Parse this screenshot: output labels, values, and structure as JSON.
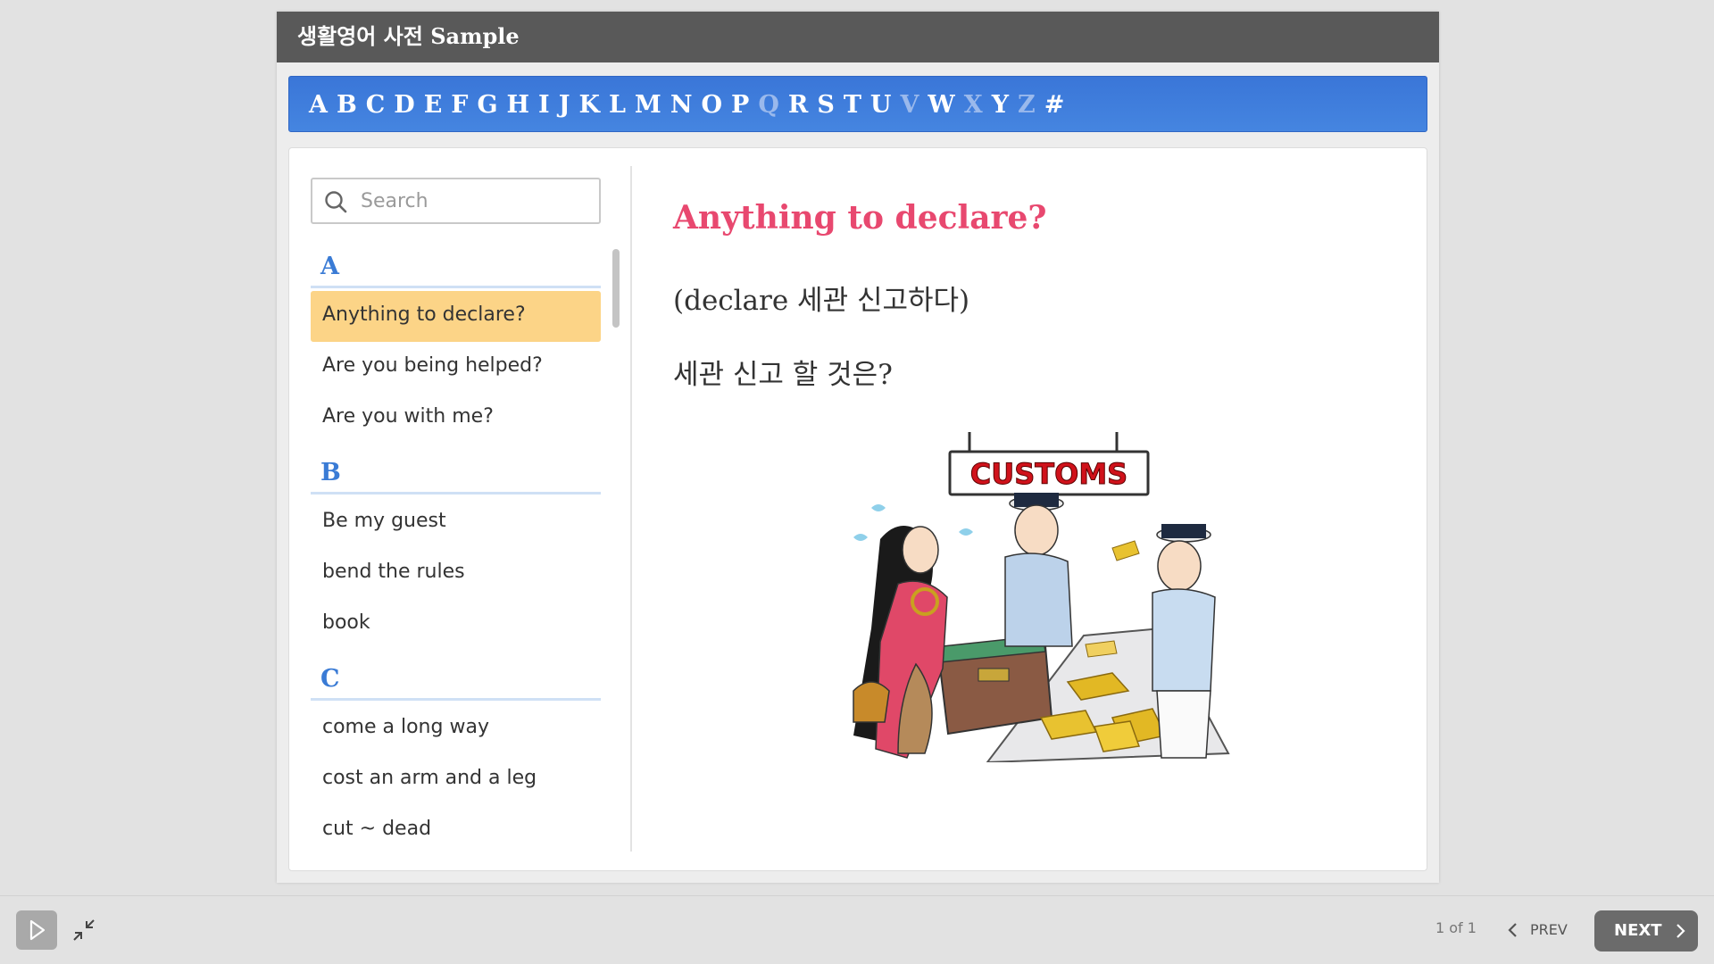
{
  "slide": {
    "title": "생활영어 사전 Sample"
  },
  "alphabet": [
    {
      "letter": "A",
      "enabled": true
    },
    {
      "letter": "B",
      "enabled": true
    },
    {
      "letter": "C",
      "enabled": true
    },
    {
      "letter": "D",
      "enabled": true
    },
    {
      "letter": "E",
      "enabled": true
    },
    {
      "letter": "F",
      "enabled": true
    },
    {
      "letter": "G",
      "enabled": true
    },
    {
      "letter": "H",
      "enabled": true
    },
    {
      "letter": "I",
      "enabled": true
    },
    {
      "letter": "J",
      "enabled": true
    },
    {
      "letter": "K",
      "enabled": true
    },
    {
      "letter": "L",
      "enabled": true
    },
    {
      "letter": "M",
      "enabled": true
    },
    {
      "letter": "N",
      "enabled": true
    },
    {
      "letter": "O",
      "enabled": true
    },
    {
      "letter": "P",
      "enabled": true
    },
    {
      "letter": "Q",
      "enabled": false
    },
    {
      "letter": "R",
      "enabled": true
    },
    {
      "letter": "S",
      "enabled": true
    },
    {
      "letter": "T",
      "enabled": true
    },
    {
      "letter": "U",
      "enabled": true
    },
    {
      "letter": "V",
      "enabled": false
    },
    {
      "letter": "W",
      "enabled": true
    },
    {
      "letter": "X",
      "enabled": false
    },
    {
      "letter": "Y",
      "enabled": true
    },
    {
      "letter": "Z",
      "enabled": false
    },
    {
      "letter": "#",
      "enabled": true
    }
  ],
  "search": {
    "placeholder": "Search",
    "value": "",
    "icon": "search-icon"
  },
  "groups": [
    {
      "letter": "A",
      "entries": [
        {
          "label": "Anything to declare?",
          "selected": true
        },
        {
          "label": "Are you being helped?",
          "selected": false
        },
        {
          "label": "Are you with me?",
          "selected": false
        }
      ]
    },
    {
      "letter": "B",
      "entries": [
        {
          "label": "Be my guest",
          "selected": false
        },
        {
          "label": "bend the rules",
          "selected": false
        },
        {
          "label": "book",
          "selected": false
        }
      ]
    },
    {
      "letter": "C",
      "entries": [
        {
          "label": "come a long way",
          "selected": false
        },
        {
          "label": "cost an arm and a leg",
          "selected": false
        },
        {
          "label": "cut ~ dead",
          "selected": false
        }
      ]
    }
  ],
  "content": {
    "title": "Anything to declare?",
    "note": "(declare 세관 신고하다)",
    "meaning": "세관 신고 할 것은?",
    "illustration": {
      "sign_text": "CUSTOMS"
    }
  },
  "player": {
    "page_count": "1 of 1",
    "prev_label": "PREV",
    "next_label": "NEXT"
  },
  "colors": {
    "title_bar": "#595959",
    "alphabet_bar": "#3a76d8",
    "selected_entry": "#fcd487",
    "phrase_title": "#e8486f",
    "group_letter": "#3a7bd5"
  }
}
